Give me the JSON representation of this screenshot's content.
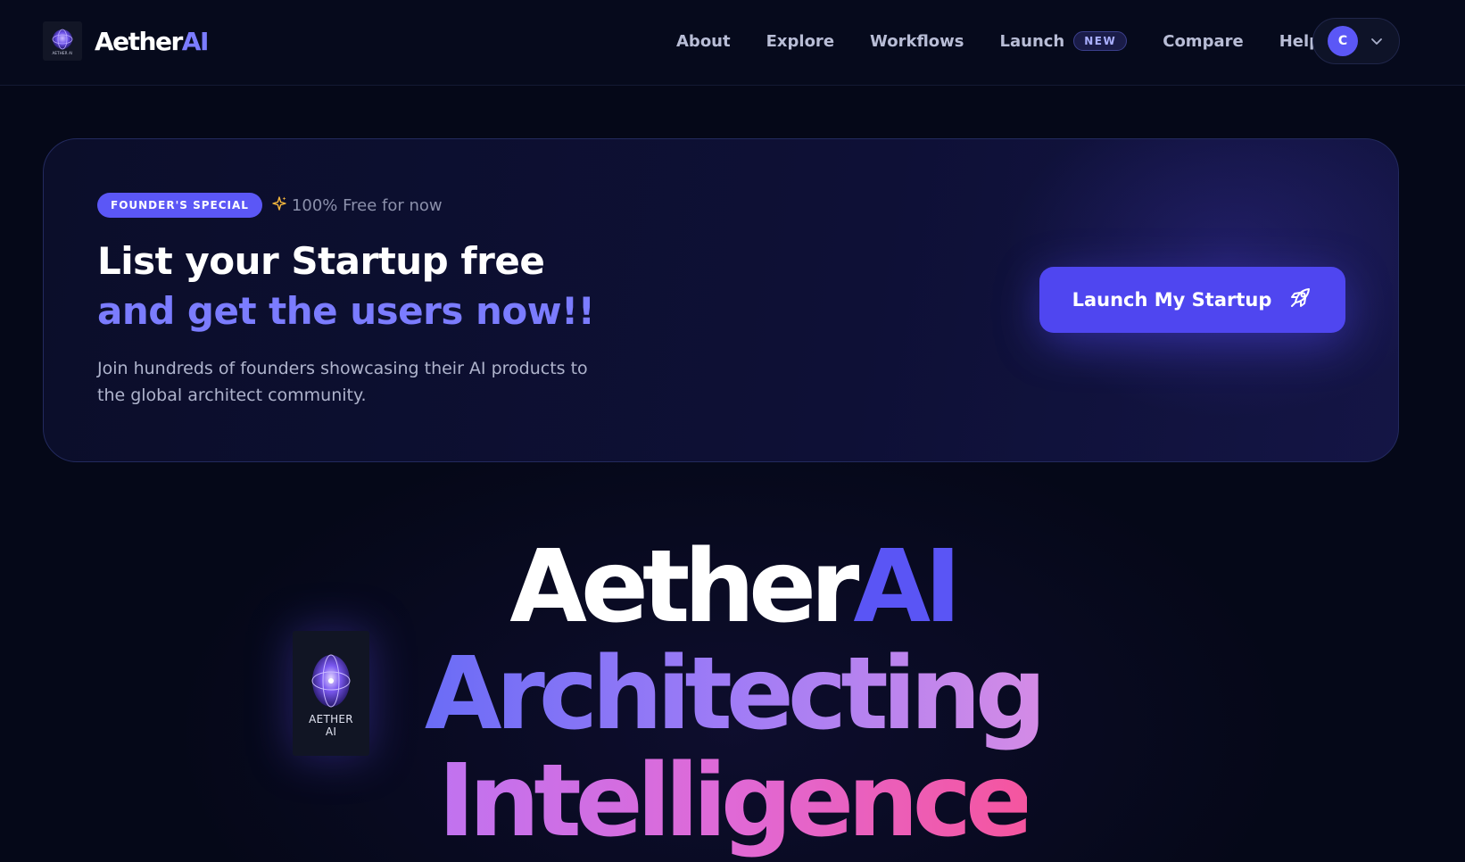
{
  "brand": {
    "name_main": "Aether",
    "name_accent": "AI",
    "logo_caption": "AETHER AI"
  },
  "nav": {
    "about": "About",
    "explore": "Explore",
    "workflows": "Workflows",
    "launch": "Launch",
    "launch_badge": "NEW",
    "compare": "Compare",
    "help": "Help"
  },
  "user": {
    "avatar_initial": "C"
  },
  "promo": {
    "badge": "FOUNDER'S SPECIAL",
    "free_note": "100% Free for now",
    "title_line1": "List your Startup free",
    "title_line2": "and get the users now!!",
    "description": "Join hundreds of founders showcasing their AI products to the global architect community.",
    "cta": "Launch My Startup"
  },
  "hero": {
    "card_caption_line1": "AETHER",
    "card_caption_line2": "AI",
    "line1_main": "Aether",
    "line1_accent": "AI",
    "line2": "Architecting",
    "line3": "Intelligence"
  },
  "colors": {
    "background": "#050818",
    "accent": "#5b57f6",
    "accent_text": "#7b7cff",
    "free_note_icon": "#f5b63d"
  },
  "icons": {
    "logo": "orb-logo-icon",
    "dropdown": "chevron-down-icon",
    "sparkle": "sparkle-icon",
    "cta": "rocket-icon"
  }
}
